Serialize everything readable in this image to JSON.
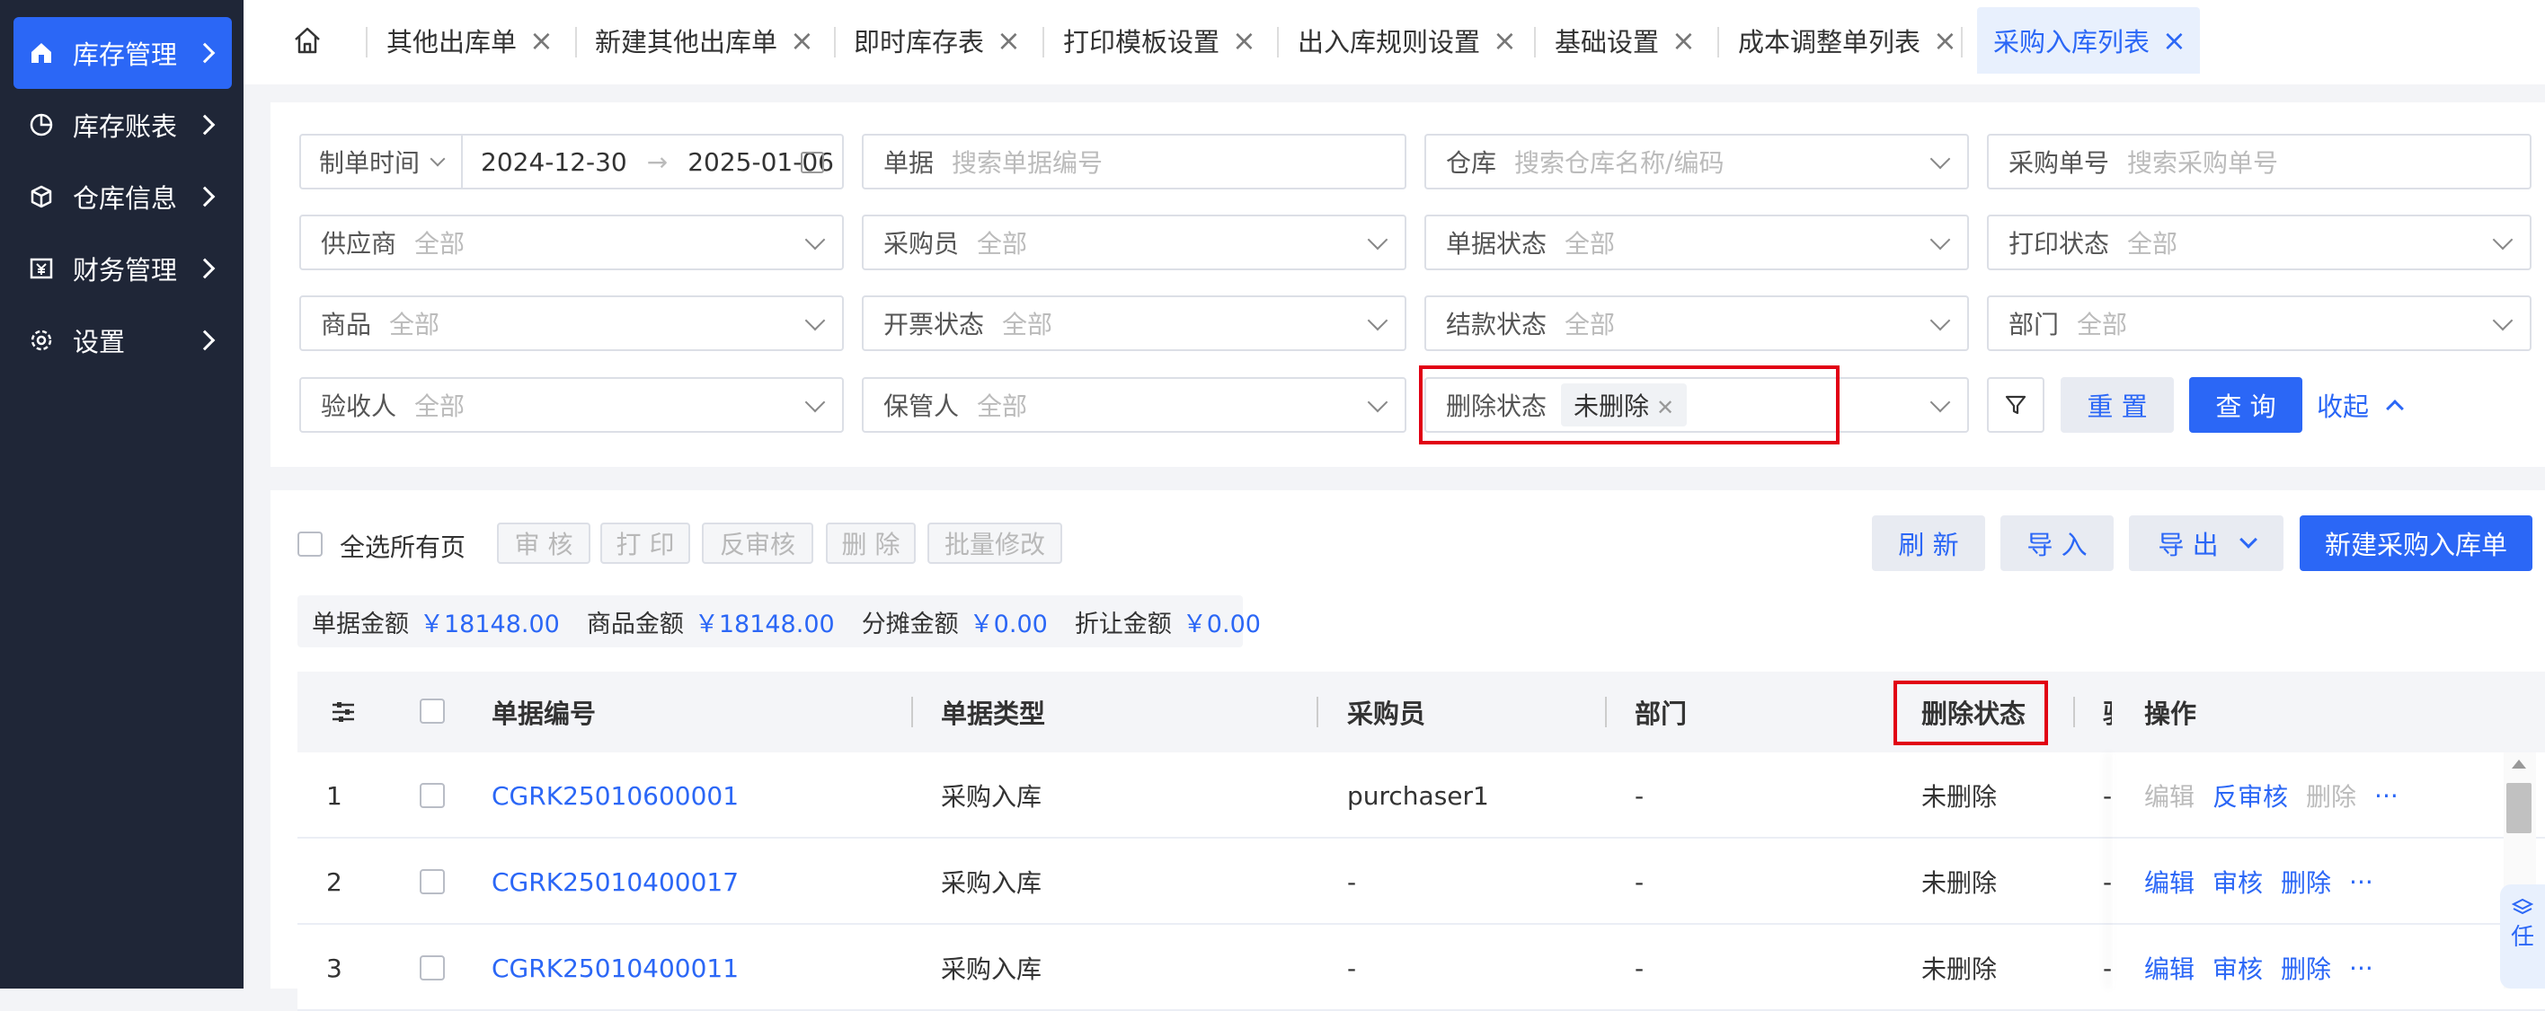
{
  "sidebar": {
    "items": [
      {
        "label": "库存管理",
        "icon": "home-icon",
        "active": true
      },
      {
        "label": "库存账表",
        "icon": "pie-chart-icon"
      },
      {
        "label": "仓库信息",
        "icon": "cube-icon"
      },
      {
        "label": "财务管理",
        "icon": "finance-icon"
      },
      {
        "label": "设置",
        "icon": "gear-icon"
      }
    ]
  },
  "tabs": [
    {
      "label": "其他出库单"
    },
    {
      "label": "新建其他出库单"
    },
    {
      "label": "即时库存表"
    },
    {
      "label": "打印模板设置"
    },
    {
      "label": "出入库规则设置"
    },
    {
      "label": "基础设置"
    },
    {
      "label": "成本调整单列表"
    },
    {
      "label": "采购入库列表",
      "active": true
    }
  ],
  "filters": {
    "date_type": "制单时间",
    "date_start": "2024-12-30",
    "date_end": "2025-01-06",
    "date_arrow": "→",
    "doc": {
      "label": "单据",
      "placeholder": "搜索单据编号"
    },
    "warehouse": {
      "label": "仓库",
      "placeholder": "搜索仓库名称/编码"
    },
    "po": {
      "label": "采购单号",
      "placeholder": "搜索采购单号"
    },
    "supplier": {
      "label": "供应商",
      "value": "全部"
    },
    "buyer": {
      "label": "采购员",
      "value": "全部"
    },
    "doc_status": {
      "label": "单据状态",
      "value": "全部"
    },
    "print_status": {
      "label": "打印状态",
      "value": "全部"
    },
    "goods": {
      "label": "商品",
      "value": "全部"
    },
    "invoice_status": {
      "label": "开票状态",
      "value": "全部"
    },
    "settle_status": {
      "label": "结款状态",
      "value": "全部"
    },
    "dept": {
      "label": "部门",
      "value": "全部"
    },
    "inspector": {
      "label": "验收人",
      "value": "全部"
    },
    "keeper": {
      "label": "保管人",
      "value": "全部"
    },
    "delete_status": {
      "label": "删除状态",
      "tag": "未删除"
    },
    "reset": "重 置",
    "query": "查 询",
    "collapse": "收起"
  },
  "toolbar": {
    "select_all": "全选所有页",
    "approve": "审 核",
    "print": "打 印",
    "unapprove": "反审核",
    "delete": "删 除",
    "batch_edit": "批量修改",
    "refresh": "刷 新",
    "import": "导 入",
    "export": "导 出",
    "create": "新建采购入库单"
  },
  "summary": {
    "doc_amount_label": "单据金额",
    "doc_amount": "￥18148.00",
    "goods_amount_label": "商品金额",
    "goods_amount": "￥18148.00",
    "alloc_amount_label": "分摊金额",
    "alloc_amount": "￥0.00",
    "discount_amount_label": "折让金额",
    "discount_amount": "￥0.00"
  },
  "table": {
    "headers": {
      "doc_no": "单据编号",
      "doc_type": "单据类型",
      "buyer": "采购员",
      "dept": "部门",
      "delete_status": "删除状态",
      "partial": "验",
      "ops": "操作"
    },
    "rows": [
      {
        "index": "1",
        "doc_no": "CGRK25010600001",
        "doc_type": "采购入库",
        "buyer": "purchaser1",
        "dept": "-",
        "delete_status": "未删除",
        "partial": "-",
        "ops": [
          {
            "label": "编辑",
            "enabled": false
          },
          {
            "label": "反审核",
            "enabled": true
          },
          {
            "label": "删除",
            "enabled": false
          }
        ]
      },
      {
        "index": "2",
        "doc_no": "CGRK25010400017",
        "doc_type": "采购入库",
        "buyer": "-",
        "dept": "-",
        "delete_status": "未删除",
        "partial": "-",
        "ops": [
          {
            "label": "编辑",
            "enabled": true
          },
          {
            "label": "审核",
            "enabled": true
          },
          {
            "label": "删除",
            "enabled": true
          }
        ]
      },
      {
        "index": "3",
        "doc_no": "CGRK25010400011",
        "doc_type": "采购入库",
        "buyer": "-",
        "dept": "-",
        "delete_status": "未删除",
        "partial": "-",
        "ops": [
          {
            "label": "编辑",
            "enabled": true
          },
          {
            "label": "审核",
            "enabled": true
          },
          {
            "label": "删除",
            "enabled": true
          }
        ]
      }
    ],
    "more": "···"
  },
  "floating": {
    "text": "任"
  },
  "colors": {
    "primary": "#2b67f6",
    "sidebar": "#1f2637",
    "highlight": "#e10014"
  }
}
